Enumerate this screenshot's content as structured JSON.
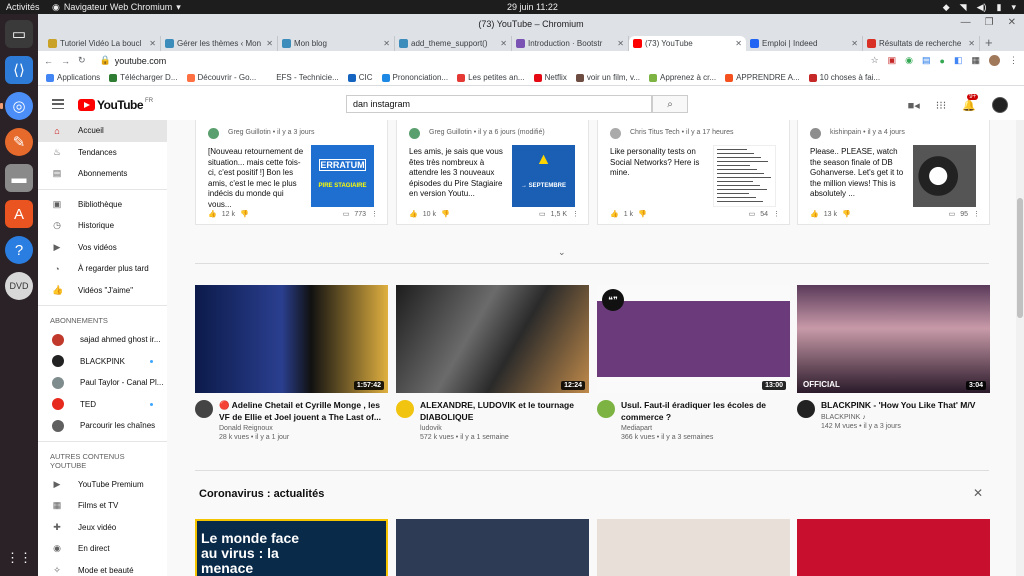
{
  "system": {
    "activities": "Activités",
    "app_name": "Navigateur Web Chromium",
    "clock": "29 juin  11:22"
  },
  "window": {
    "title": "(73) YouTube – Chromium"
  },
  "tabs": [
    {
      "label": "Tutoriel Vidéo La boucl",
      "fav_color": "#c9a227"
    },
    {
      "label": "Gérer les thèmes ‹ Mon",
      "fav_color": "#3c8dbc"
    },
    {
      "label": "Mon blog",
      "fav_color": "#3c8dbc"
    },
    {
      "label": "add_theme_support()",
      "fav_color": "#3c8dbc"
    },
    {
      "label": "Introduction · Bootstr",
      "fav_color": "#7952b3"
    },
    {
      "label": "(73) YouTube",
      "fav_color": "#ff0000",
      "active": true
    },
    {
      "label": "Emploi | Indeed",
      "fav_color": "#2164f3"
    },
    {
      "label": "Résultats de recherche",
      "fav_color": "#d93025"
    }
  ],
  "omnibox": {
    "url": "youtube.com"
  },
  "bookmarks": [
    {
      "label": "Applications",
      "color": "#4285f4"
    },
    {
      "label": "Télécharger D...",
      "color": "#2e7d32"
    },
    {
      "label": "Découvrir - Go...",
      "color": "#ff7043"
    },
    {
      "label": "EFS - Technicie...",
      "color": "#ffffff"
    },
    {
      "label": "CIC",
      "color": "#1565c0"
    },
    {
      "label": "Prononciation...",
      "color": "#1e88e5"
    },
    {
      "label": "Les petites an...",
      "color": "#e53935"
    },
    {
      "label": "Netflix",
      "color": "#e50914"
    },
    {
      "label": "voir un film, v...",
      "color": "#6d4c41"
    },
    {
      "label": "Apprenez à cr...",
      "color": "#7cb342"
    },
    {
      "label": "APPRENDRE A...",
      "color": "#f4511e"
    },
    {
      "label": "10 choses à fai...",
      "color": "#c62828"
    }
  ],
  "youtube": {
    "logo": "YouTube",
    "region": "FR",
    "search_value": "dan instagram",
    "notifications": "9+",
    "sidebar": {
      "main": [
        {
          "label": "Accueil",
          "icon": "home-icon",
          "glyph": "⌂",
          "active": true
        },
        {
          "label": "Tendances",
          "icon": "flame-icon",
          "glyph": "♨"
        },
        {
          "label": "Abonnements",
          "icon": "subscriptions-icon",
          "glyph": "▤"
        }
      ],
      "library": [
        {
          "label": "Bibliothèque",
          "icon": "library-icon",
          "glyph": "▣"
        },
        {
          "label": "Historique",
          "icon": "history-icon",
          "glyph": "◷"
        },
        {
          "label": "Vos vidéos",
          "icon": "your-videos-icon",
          "glyph": "▶"
        },
        {
          "label": "À regarder plus tard",
          "icon": "watch-later-icon",
          "glyph": "◔"
        },
        {
          "label": "Vidéos \"J'aime\"",
          "icon": "like-icon",
          "glyph": "👍"
        }
      ],
      "subs_heading": "ABONNEMENTS",
      "subscriptions": [
        {
          "label": "sajad ahmed ghost ir...",
          "color": "#c0392b",
          "dot": false
        },
        {
          "label": "BLACKPINK",
          "color": "#222222",
          "dot": true
        },
        {
          "label": "Paul Taylor - Canal Pl...",
          "color": "#7f8c8d",
          "dot": false
        },
        {
          "label": "TED",
          "color": "#e62b1e",
          "dot": true
        },
        {
          "label": "Parcourir les chaînes",
          "color": "#606060",
          "dot": false
        }
      ],
      "more_heading": "AUTRES CONTENUS YOUTUBE",
      "more": [
        {
          "label": "YouTube Premium",
          "icon": "youtube-premium-icon",
          "glyph": "▶"
        },
        {
          "label": "Films et TV",
          "icon": "films-icon",
          "glyph": "▦"
        },
        {
          "label": "Jeux vidéo",
          "icon": "gaming-icon",
          "glyph": "✚"
        },
        {
          "label": "En direct",
          "icon": "live-icon",
          "glyph": "◉"
        },
        {
          "label": "Mode et beauté",
          "icon": "fashion-icon",
          "glyph": "✧"
        }
      ]
    },
    "posts": [
      {
        "author": "Greg Guillotin",
        "time": "• il y a 3 jours",
        "text": "[Nouveau retournement de situation... mais cette fois-ci, c'est positif !] Bon les amis, c'est le mec le plus indécis du monde qui vous...",
        "likes": "12 k",
        "comments": "773",
        "img_color": "#1f6fd1",
        "avatar_color": "#5aa06e"
      },
      {
        "author": "Greg Guillotin",
        "time": "• il y a 6 jours (modifié)",
        "text": "Les amis, je sais que vous êtes très nombreux à attendre les 3 nouveaux épisodes du Pire Stagiaire en version Youtu...",
        "likes": "10 k",
        "comments": "1,5 K",
        "img_color": "#1a5fb4",
        "avatar_color": "#5aa06e"
      },
      {
        "author": "Chris Titus Tech",
        "time": "• il y a 17 heures",
        "text": "Like personality tests on Social Networks? Here is mine.",
        "likes": "1 k",
        "comments": "54",
        "img_color": "#ffffff",
        "avatar_color": "#aaaaaa"
      },
      {
        "author": "kishinpain",
        "time": "• il y a 4 jours",
        "text": "Please.. PLEASE, watch the season finale of DB Gohanverse. Let's get it to the million views! This is absolutely ...",
        "likes": "13 k",
        "comments": "95",
        "img_color": "#333333",
        "avatar_color": "#8e8e8e"
      }
    ],
    "videos": [
      {
        "title": "🔴 Adeline Chetail et Cyrille Monge , les VF de Ellie et Joel jouent a The Last of...",
        "channel": "Donald Reignoux",
        "stats": "28 k vues • il y a 1 jour",
        "duration": "1:57:42",
        "thumb_color": "#1b2a5a",
        "avatar_color": "#444444"
      },
      {
        "title": "ALEXANDRE, LUDOVIK et le tournage DIABOLIQUE",
        "channel": "ludovik",
        "stats": "572 k vues • il y a 1 semaine",
        "duration": "12:24",
        "thumb_color": "#3b3b3b",
        "avatar_color": "#f1c40f"
      },
      {
        "title": "Usul. Faut-il éradiquer les écoles de commerce ?",
        "channel": "Mediapart",
        "stats": "366 k vues • il y a 3 semaines",
        "duration": "13:00",
        "thumb_color": "#7a4b8e",
        "avatar_color": "#7cb342"
      },
      {
        "title": "BLACKPINK - 'How You Like That' M/V",
        "channel": "BLACKPINK ♪",
        "stats": "142 M vues • il y a 3 jours",
        "duration": "3:04",
        "thumb_color": "#4a2a3a",
        "avatar_color": "#222222"
      }
    ],
    "shelf": {
      "title": "Coronavirus : actualités",
      "news_headline": "Le monde face au virus : la menace",
      "news": [
        {
          "color": "#0a2a4a"
        },
        {
          "color": "#2d3b55"
        },
        {
          "color": "#e8e0d8"
        },
        {
          "color": "#c8102e"
        }
      ]
    },
    "post_overlays": {
      "erratum": "ERRATUM",
      "stagiaire": "PIRE STAGIAIRE",
      "septembre": "→ SEPTEMBRE",
      "official": "OFFICIAL"
    }
  }
}
